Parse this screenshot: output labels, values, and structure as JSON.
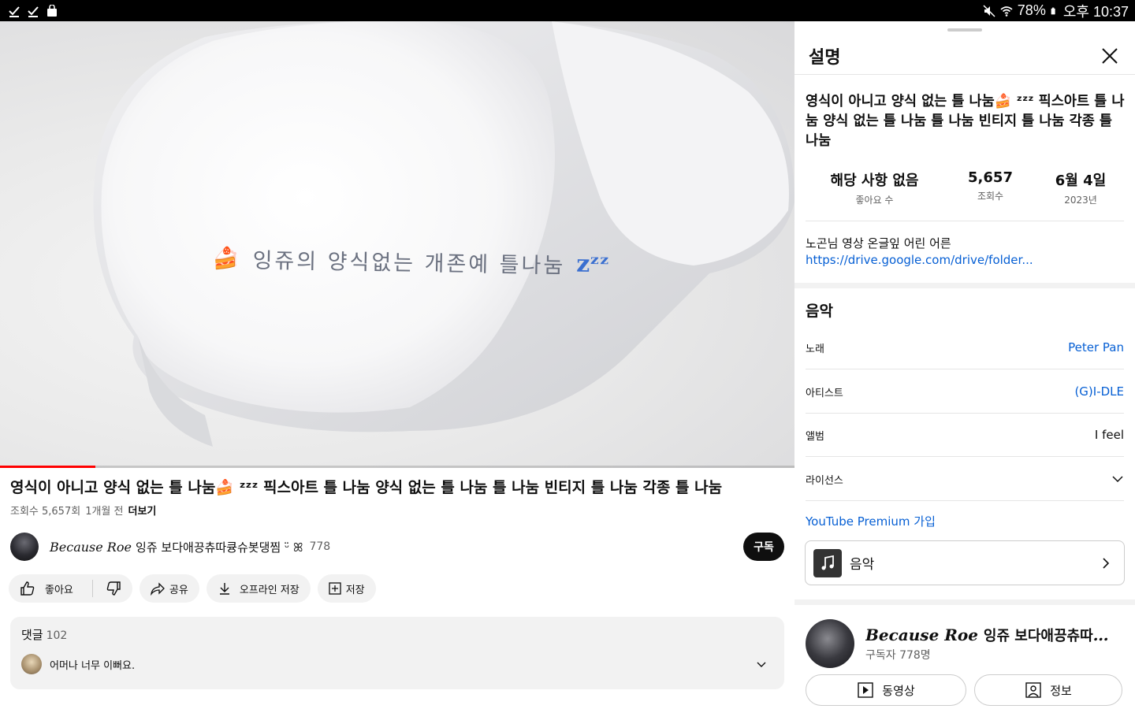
{
  "status_bar": {
    "battery": "78%",
    "time": "오후 10:37"
  },
  "video": {
    "overlay_text": "잉쥬의 양식없는 개존예 틀나눔",
    "overlay_emoji": "🍰",
    "overlay_zzz": "zᶻᶻ",
    "progress": 0.12
  },
  "title": "영식이 아니고 양식 없는 틀 나눔🍰 ᶻᶻᶻ 픽스아트 틀 나눔 양식 없는 틀 나눔 틀 나눔 빈티지 틀 나눔 각종 틀 나눔",
  "meta": {
    "views": "조회수 5,657회",
    "ago": "1개월 전",
    "more": "더보기"
  },
  "channel": {
    "name_en": "Because Roe",
    "name_kr": "잉쥬 보다애끙츄따큥슈봇댕찜 ᵕ̈ ꕤ",
    "subs": "778",
    "subscribe": "구독"
  },
  "actions": {
    "like": "좋아요",
    "share": "공유",
    "download": "오프라인 저장",
    "save": "저장"
  },
  "comments": {
    "label": "댓글",
    "count": "102",
    "first": "어머나 너무 이뻐요."
  },
  "panel": {
    "title": "설명",
    "desc_title": "영식이 아니고 양식 없는 틀 나눔🍰 ᶻᶻᶻ 픽스아트 틀 나눔 양식 없는 틀 나눔 틀 나눔 빈티지 틀 나눔 각종 틀 나눔",
    "stats": [
      {
        "value": "해당 사항 없음",
        "label": "좋아요 수"
      },
      {
        "value": "5,657",
        "label": "조회수"
      },
      {
        "value": "6월 4일",
        "label": "2023년"
      }
    ],
    "desc_text": "노곤님 영상 온글잎 어린 어른",
    "desc_link": "https://drive.google.com/drive/folder...",
    "music_title": "음악",
    "music_rows": [
      {
        "label": "노래",
        "value": "Peter Pan",
        "link": true
      },
      {
        "label": "아티스트",
        "value": "(G)I-DLE",
        "link": true
      },
      {
        "label": "앨범",
        "value": "I feel",
        "link": false
      },
      {
        "label": "라이선스",
        "value": "",
        "link": false
      }
    ],
    "premium": "YouTube Premium 가입",
    "music_button": "음악",
    "channel_card": {
      "name_en": "Because Roe",
      "name_kr": "잉쥬 보다애끙츄따큥슈...",
      "subs": "구독자 778명"
    },
    "videos_button": "동영상",
    "about_button": "정보"
  }
}
